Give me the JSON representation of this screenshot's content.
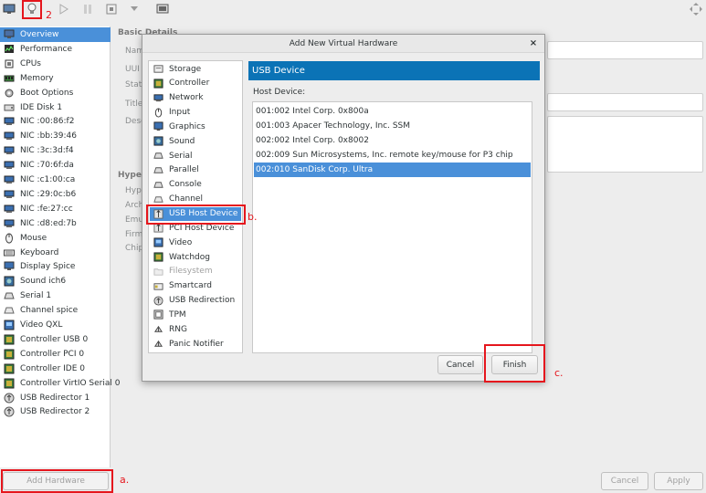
{
  "toolbar": {
    "icons": [
      "monitor-icon",
      "lightbulb-icon",
      "play-icon",
      "pause-icon",
      "power-icon",
      "dropdown-icon",
      "screenshot-icon",
      "fullscreen-icon"
    ]
  },
  "sidebar": {
    "items": [
      {
        "label": "Overview",
        "icon": "monitor-icon",
        "selected": true
      },
      {
        "label": "Performance",
        "icon": "chart-icon"
      },
      {
        "label": "CPUs",
        "icon": "chip-icon"
      },
      {
        "label": "Memory",
        "icon": "memory-icon"
      },
      {
        "label": "Boot Options",
        "icon": "gear-icon"
      },
      {
        "label": "IDE Disk 1",
        "icon": "disk-icon"
      },
      {
        "label": "NIC :00:86:f2",
        "icon": "network-icon"
      },
      {
        "label": "NIC :bb:39:46",
        "icon": "network-icon"
      },
      {
        "label": "NIC :3c:3d:f4",
        "icon": "network-icon"
      },
      {
        "label": "NIC :70:6f:da",
        "icon": "network-icon"
      },
      {
        "label": "NIC :c1:00:ca",
        "icon": "network-icon"
      },
      {
        "label": "NIC :29:0c:b6",
        "icon": "network-icon"
      },
      {
        "label": "NIC :fe:27:cc",
        "icon": "network-icon"
      },
      {
        "label": "NIC :d8:ed:7b",
        "icon": "network-icon"
      },
      {
        "label": "Mouse",
        "icon": "mouse-icon"
      },
      {
        "label": "Keyboard",
        "icon": "keyboard-icon"
      },
      {
        "label": "Display Spice",
        "icon": "display-icon"
      },
      {
        "label": "Sound ich6",
        "icon": "sound-icon"
      },
      {
        "label": "Serial 1",
        "icon": "serial-icon"
      },
      {
        "label": "Channel spice",
        "icon": "channel-icon"
      },
      {
        "label": "Video QXL",
        "icon": "video-icon"
      },
      {
        "label": "Controller USB 0",
        "icon": "controller-icon"
      },
      {
        "label": "Controller PCI 0",
        "icon": "controller-icon"
      },
      {
        "label": "Controller IDE 0",
        "icon": "controller-icon"
      },
      {
        "label": "Controller VirtIO Serial 0",
        "icon": "controller-icon"
      },
      {
        "label": "USB Redirector 1",
        "icon": "usb-redirect-icon"
      },
      {
        "label": "USB Redirector 2",
        "icon": "usb-redirect-icon"
      }
    ],
    "add_hardware_label": "Add Hardware"
  },
  "details": {
    "section_basic": "Basic Details",
    "labels": [
      "Nam",
      "UUI",
      "Stat",
      "Title",
      "Desc"
    ],
    "section_hypervisor": "Hyper",
    "hyper_labels": [
      "Hype",
      "Arch",
      "Emu",
      "Firm",
      "Chip"
    ],
    "cancel_label": "Cancel",
    "apply_label": "Apply"
  },
  "dialog": {
    "title": "Add New Virtual Hardware",
    "close_glyph": "×",
    "hardware_types": [
      {
        "label": "Storage",
        "icon": "storage-icon"
      },
      {
        "label": "Controller",
        "icon": "controller-icon"
      },
      {
        "label": "Network",
        "icon": "network-icon"
      },
      {
        "label": "Input",
        "icon": "input-icon"
      },
      {
        "label": "Graphics",
        "icon": "graphics-icon"
      },
      {
        "label": "Sound",
        "icon": "sound-icon"
      },
      {
        "label": "Serial",
        "icon": "serial-icon"
      },
      {
        "label": "Parallel",
        "icon": "parallel-icon"
      },
      {
        "label": "Console",
        "icon": "console-icon"
      },
      {
        "label": "Channel",
        "icon": "channel-icon"
      },
      {
        "label": "USB Host Device",
        "icon": "usb-icon",
        "selected": true
      },
      {
        "label": "PCI Host Device",
        "icon": "pci-icon"
      },
      {
        "label": "Video",
        "icon": "video-icon"
      },
      {
        "label": "Watchdog",
        "icon": "watchdog-icon"
      },
      {
        "label": "Filesystem",
        "icon": "folder-icon",
        "disabled": true
      },
      {
        "label": "Smartcard",
        "icon": "smartcard-icon"
      },
      {
        "label": "USB Redirection",
        "icon": "usb-redirect-icon"
      },
      {
        "label": "TPM",
        "icon": "tpm-icon"
      },
      {
        "label": "RNG",
        "icon": "rng-icon"
      },
      {
        "label": "Panic Notifier",
        "icon": "panic-icon"
      }
    ],
    "section_title": "USB Device",
    "host_device_label": "Host Device:",
    "devices": [
      {
        "label": "001:002 Intel Corp. 0x800a"
      },
      {
        "label": "001:003 Apacer Technology, Inc. SSM"
      },
      {
        "label": "002:002 Intel Corp. 0x8002"
      },
      {
        "label": "002:009 Sun Microsystems, Inc. remote key/mouse for P3 chip"
      },
      {
        "label": "002:010 SanDisk Corp. Ultra",
        "selected": true
      }
    ],
    "cancel_label": "Cancel",
    "finish_label": "Finish"
  },
  "annotations": {
    "step_2": "2",
    "step_a": "a.",
    "step_b": "b.",
    "step_c": "c."
  },
  "colors": {
    "selection": "#4a90d9",
    "header_blue": "#0b73b6",
    "annotation_red": "#e5161d"
  }
}
